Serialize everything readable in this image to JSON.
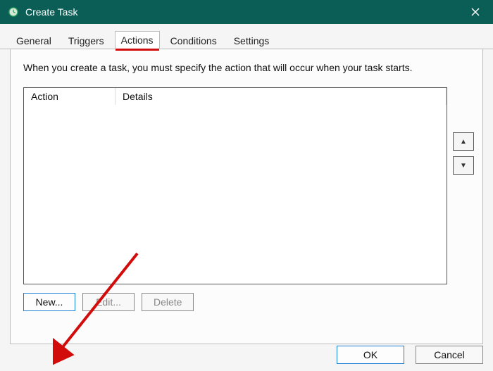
{
  "window": {
    "title": "Create Task",
    "close_label": "Close"
  },
  "tabs": {
    "general": "General",
    "triggers": "Triggers",
    "actions": "Actions",
    "conditions": "Conditions",
    "settings": "Settings"
  },
  "main": {
    "description": "When you create a task, you must specify the action that will occur when your task starts.",
    "columns": {
      "action": "Action",
      "details": "Details"
    },
    "buttons": {
      "move_up": "▲",
      "move_down": "▼",
      "new": "New...",
      "edit": "Edit...",
      "delete": "Delete"
    }
  },
  "footer": {
    "ok": "OK",
    "cancel": "Cancel"
  },
  "colors": {
    "titlebar": "#0b5e56",
    "underline": "#d20b0b",
    "primary_border": "#1e7fd6",
    "arrow": "#d20b0b"
  }
}
